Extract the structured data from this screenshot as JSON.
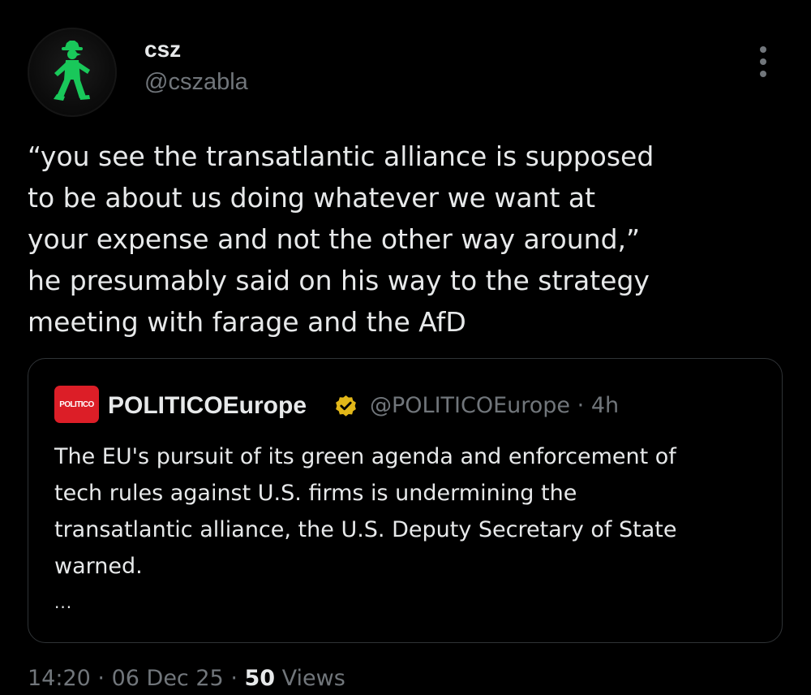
{
  "author": {
    "display_name": "csz",
    "handle": "@cszabla",
    "avatar_icon": "green-traffic-light-man-icon"
  },
  "tweet": {
    "text": "“you see the transatlantic alliance is supposed\nto be about us doing whatever we want at\nyour expense and not the other way around,”\nhe presumably said on his way to the strategy\nmeeting with farage and the AfD"
  },
  "quote": {
    "logo_text": "POLITICO",
    "display_name": "POLITICOEurope",
    "verified_icon": "gold-verified-badge-icon",
    "handle": "@POLITICOEurope",
    "separator": "·",
    "time": "4h",
    "text": "The EU's pursuit of its green agenda and enforcement of\ntech rules against U.S. firms is undermining the\ntransatlantic alliance, the U.S. Deputy Secretary of State\nwarned.",
    "ellipsis": "..."
  },
  "meta": {
    "time": "14:20",
    "separator": "·",
    "date": "06 Dec 25",
    "views_count": "50",
    "views_label": "Views"
  },
  "colors": {
    "background": "#000000",
    "text_primary": "#e7e9ea",
    "text_secondary": "#71767b",
    "border": "#2f3336",
    "politico_red": "#dc1e27",
    "verified_gold": "#e2b719",
    "avatar_figure_green": "#19c85a"
  }
}
